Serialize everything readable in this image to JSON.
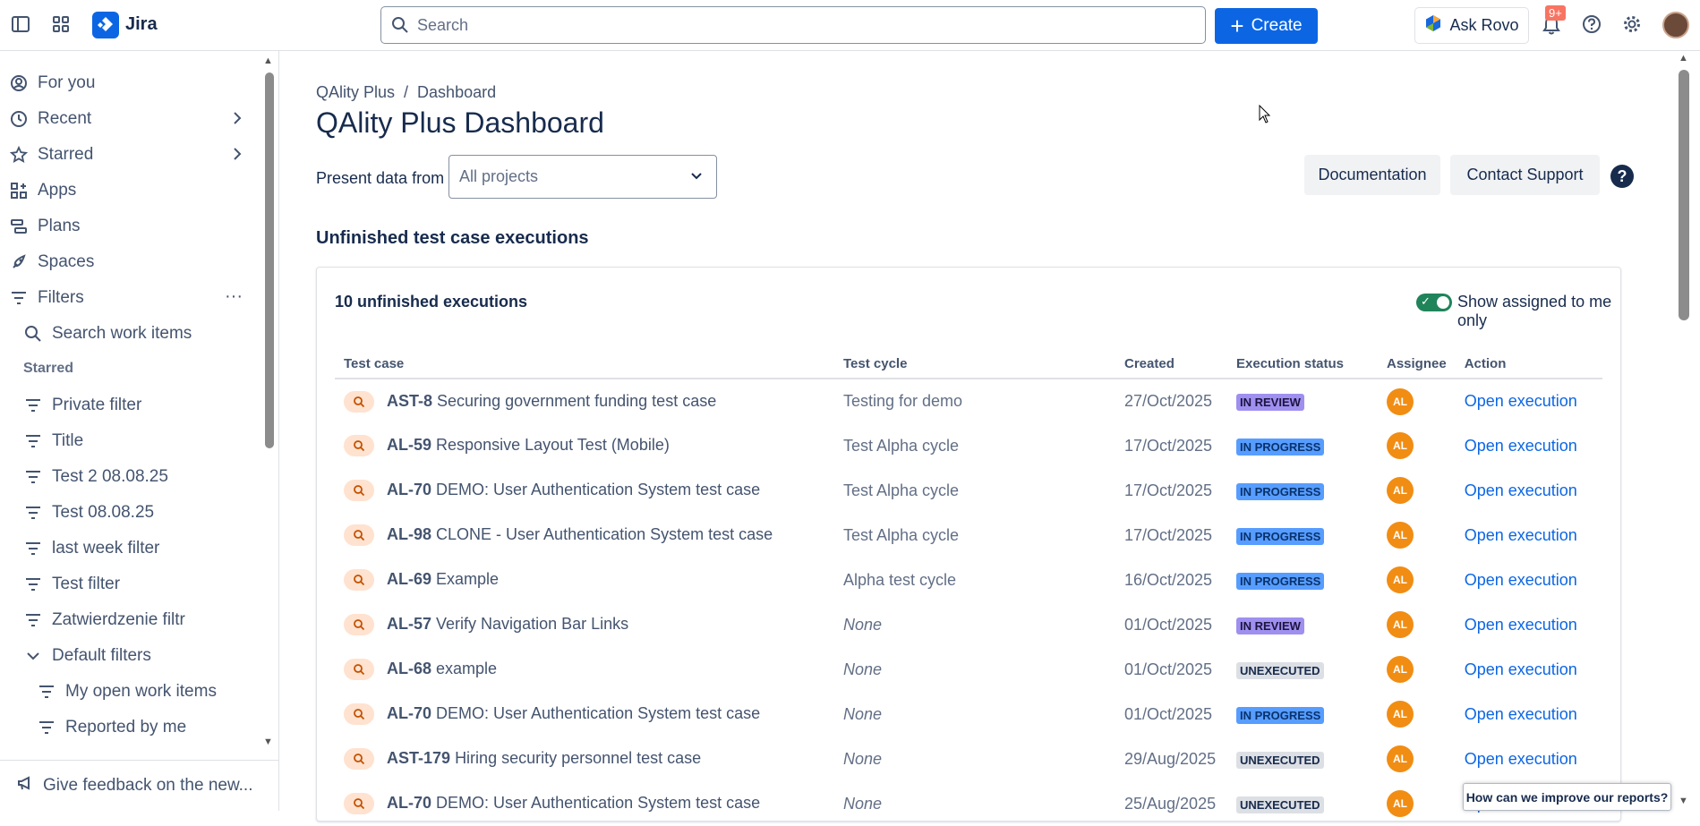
{
  "app": {
    "name": "Jira"
  },
  "topbar": {
    "search_placeholder": "Search",
    "create_label": "Create",
    "rovo_label": "Ask Rovo",
    "notifications_badge": "9+"
  },
  "sidebar": {
    "items": [
      {
        "label": "For you",
        "icon": "user-circle-icon"
      },
      {
        "label": "Recent",
        "icon": "clock-icon",
        "chevron": true
      },
      {
        "label": "Starred",
        "icon": "star-icon",
        "chevron": true
      },
      {
        "label": "Apps",
        "icon": "apps-icon"
      },
      {
        "label": "Plans",
        "icon": "plans-icon"
      },
      {
        "label": "Spaces",
        "icon": "rocket-icon"
      },
      {
        "label": "Filters",
        "icon": "filter-icon",
        "more": true
      },
      {
        "label": "Search work items",
        "icon": "search-icon"
      }
    ],
    "starred_header": "Starred",
    "filters": [
      "Private filter",
      "Title",
      "Test 2 08.08.25",
      "Test 08.08.25",
      "last week filter",
      "Test filter",
      "Zatwierdzenie filtr"
    ],
    "default_filters_label": "Default filters",
    "default_filters": [
      "My open work items",
      "Reported by me"
    ],
    "feedback_label": "Give feedback on the new..."
  },
  "main": {
    "breadcrumb": [
      "QAlity Plus",
      "Dashboard"
    ],
    "breadcrumb_sep": "/",
    "title": "QAlity Plus Dashboard",
    "present_label": "Present data from",
    "project_select": "All projects",
    "documentation_label": "Documentation",
    "support_label": "Contact Support",
    "help_glyph": "?",
    "section_title": "Unfinished test case executions",
    "count_label": "10 unfinished executions",
    "toggle_label": "Show assigned to me only",
    "toggle_on": true,
    "columns": [
      "Test case",
      "Test cycle",
      "Created",
      "Execution status",
      "Assignee",
      "Action"
    ],
    "rows": [
      {
        "key": "AST-8",
        "name": "Securing government funding test case",
        "cycle": "Testing for demo",
        "created": "27/Oct/2025",
        "status": "IN REVIEW",
        "assignee": "AL",
        "action": "Open execution"
      },
      {
        "key": "AL-59",
        "name": "Responsive Layout Test (Mobile)",
        "cycle": "Test Alpha cycle",
        "created": "17/Oct/2025",
        "status": "IN PROGRESS",
        "assignee": "AL",
        "action": "Open execution"
      },
      {
        "key": "AL-70",
        "name": "DEMO: User Authentication System test case",
        "cycle": "Test Alpha cycle",
        "created": "17/Oct/2025",
        "status": "IN PROGRESS",
        "assignee": "AL",
        "action": "Open execution"
      },
      {
        "key": "AL-98",
        "name": "CLONE - User Authentication System test case",
        "cycle": "Test Alpha cycle",
        "created": "17/Oct/2025",
        "status": "IN PROGRESS",
        "assignee": "AL",
        "action": "Open execution"
      },
      {
        "key": "AL-69",
        "name": "Example",
        "cycle": "Alpha test cycle",
        "created": "16/Oct/2025",
        "status": "IN PROGRESS",
        "assignee": "AL",
        "action": "Open execution"
      },
      {
        "key": "AL-57",
        "name": "Verify Navigation Bar Links",
        "cycle": "None",
        "created": "01/Oct/2025",
        "status": "IN REVIEW",
        "assignee": "AL",
        "action": "Open execution"
      },
      {
        "key": "AL-68",
        "name": "example",
        "cycle": "None",
        "created": "01/Oct/2025",
        "status": "UNEXECUTED",
        "assignee": "AL",
        "action": "Open execution"
      },
      {
        "key": "AL-70",
        "name": "DEMO: User Authentication System test case",
        "cycle": "None",
        "created": "01/Oct/2025",
        "status": "IN PROGRESS",
        "assignee": "AL",
        "action": "Open execution"
      },
      {
        "key": "AST-179",
        "name": "Hiring security personnel test case",
        "cycle": "None",
        "created": "29/Aug/2025",
        "status": "UNEXECUTED",
        "assignee": "AL",
        "action": "Open execution"
      },
      {
        "key": "AL-70",
        "name": "DEMO: User Authentication System test case",
        "cycle": "None",
        "created": "25/Aug/2025",
        "status": "UNEXECUTED",
        "assignee": "AL",
        "action": "Open execution"
      }
    ],
    "status_colors": {
      "IN REVIEW": {
        "bg": "#9f8fef",
        "fg": "#1d1440"
      },
      "IN PROGRESS": {
        "bg": "#579dff",
        "fg": "#09326c"
      },
      "UNEXECUTED": {
        "bg": "#dcdfe4",
        "fg": "#172b4d"
      }
    },
    "survey_label": "How can we improve our reports?"
  },
  "colors": {
    "brand": "#0c66e4",
    "toggle_on": "#1f845a",
    "avatar": "#f18d13"
  }
}
